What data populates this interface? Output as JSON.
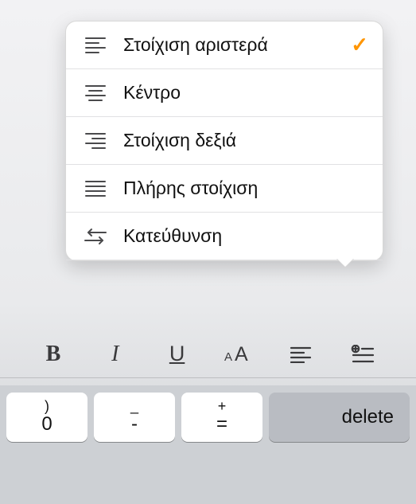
{
  "menu": {
    "items": [
      {
        "label": "Στοίχιση αριστερά",
        "icon": "align-left",
        "selected": true
      },
      {
        "label": "Κέντρο",
        "icon": "align-center",
        "selected": false
      },
      {
        "label": "Στοίχιση δεξιά",
        "icon": "align-right",
        "selected": false
      },
      {
        "label": "Πλήρης στοίχιση",
        "icon": "align-justify",
        "selected": false
      },
      {
        "label": "Κατεύθυνση",
        "icon": "direction",
        "selected": false
      }
    ]
  },
  "toolbar": {
    "bold": "B",
    "italic": "I",
    "underline": "U"
  },
  "keyboard": {
    "keys": [
      {
        "upper": ")",
        "lower": "0"
      },
      {
        "upper": "_",
        "lower": "-"
      },
      {
        "upper": "+",
        "lower": "="
      }
    ],
    "delete": "delete"
  },
  "colors": {
    "accent": "#FF9500"
  }
}
